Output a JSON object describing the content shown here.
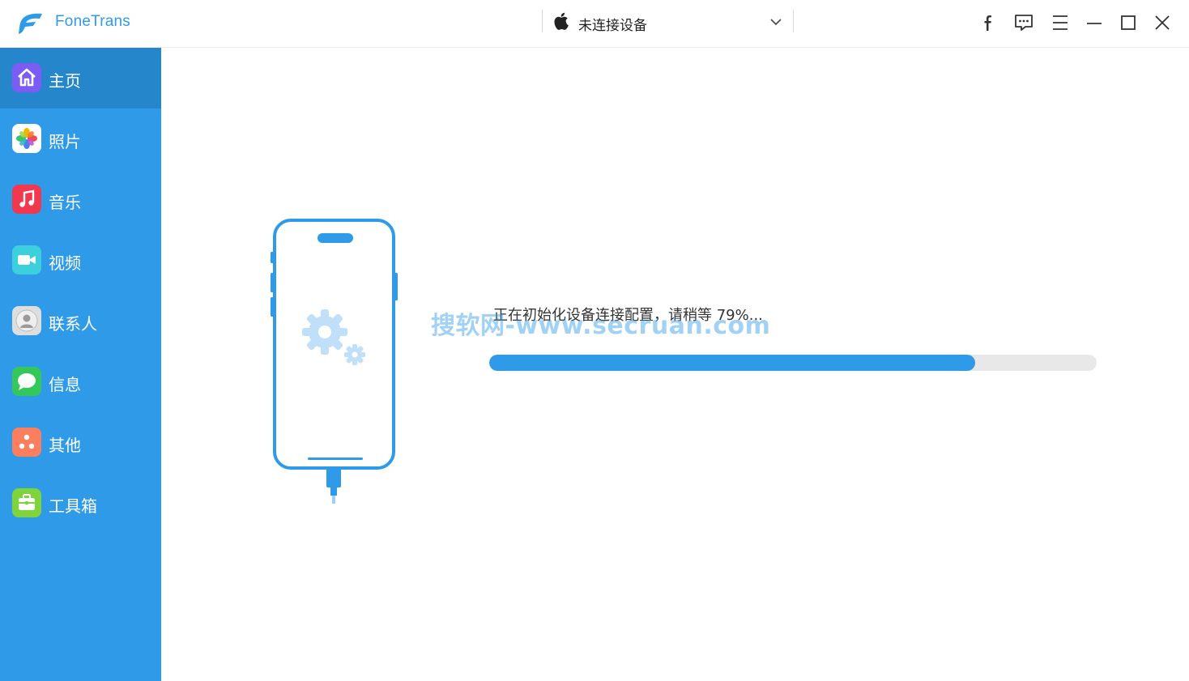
{
  "app": {
    "name": "FoneTrans",
    "brand_color": "#2f9be8"
  },
  "titlebar": {
    "device_label": "未连接设备",
    "buttons": [
      "facebook-icon",
      "feedback-icon",
      "menu-icon",
      "minimize-icon",
      "maximize-icon",
      "close-icon"
    ]
  },
  "sidebar": {
    "items": [
      {
        "label": "主页",
        "icon": "home-icon",
        "active": true
      },
      {
        "label": "照片",
        "icon": "photos-icon"
      },
      {
        "label": "音乐",
        "icon": "music-icon"
      },
      {
        "label": "视频",
        "icon": "video-icon"
      },
      {
        "label": "联系人",
        "icon": "contacts-icon"
      },
      {
        "label": "信息",
        "icon": "messages-icon"
      },
      {
        "label": "其他",
        "icon": "other-icon"
      },
      {
        "label": "工具箱",
        "icon": "toolbox-icon"
      }
    ]
  },
  "main": {
    "status_text": "正在初始化设备连接配置，请稍等 79%...",
    "progress_fraction": 0.8,
    "watermark": "搜软网-www.secruan.com"
  }
}
